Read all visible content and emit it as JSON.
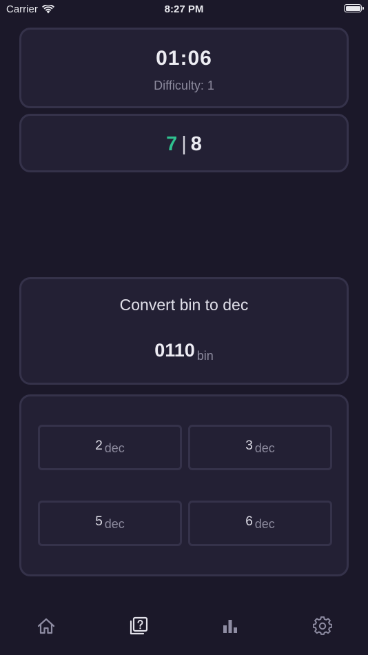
{
  "status_bar": {
    "carrier": "Carrier",
    "time": "8:27 PM"
  },
  "timer": {
    "value": "01:06",
    "difficulty": "Difficulty: 1"
  },
  "score": {
    "correct": "7",
    "separator": "|",
    "total": "8",
    "correct_color": "#2fc08f"
  },
  "question": {
    "prompt": "Convert bin to dec",
    "value": "0110",
    "unit": "bin"
  },
  "answers": [
    {
      "value": "2",
      "unit": "dec"
    },
    {
      "value": "3",
      "unit": "dec"
    },
    {
      "value": "5",
      "unit": "dec"
    },
    {
      "value": "6",
      "unit": "dec"
    }
  ],
  "tab_bar": {
    "tabs": [
      {
        "icon": "home-icon"
      },
      {
        "icon": "quiz-icon",
        "active": true
      },
      {
        "icon": "stats-icon"
      },
      {
        "icon": "gear-icon"
      }
    ]
  },
  "colors": {
    "background": "#1b1829",
    "card": "#232034",
    "border": "#35324a",
    "accent": "#2fc08f"
  }
}
